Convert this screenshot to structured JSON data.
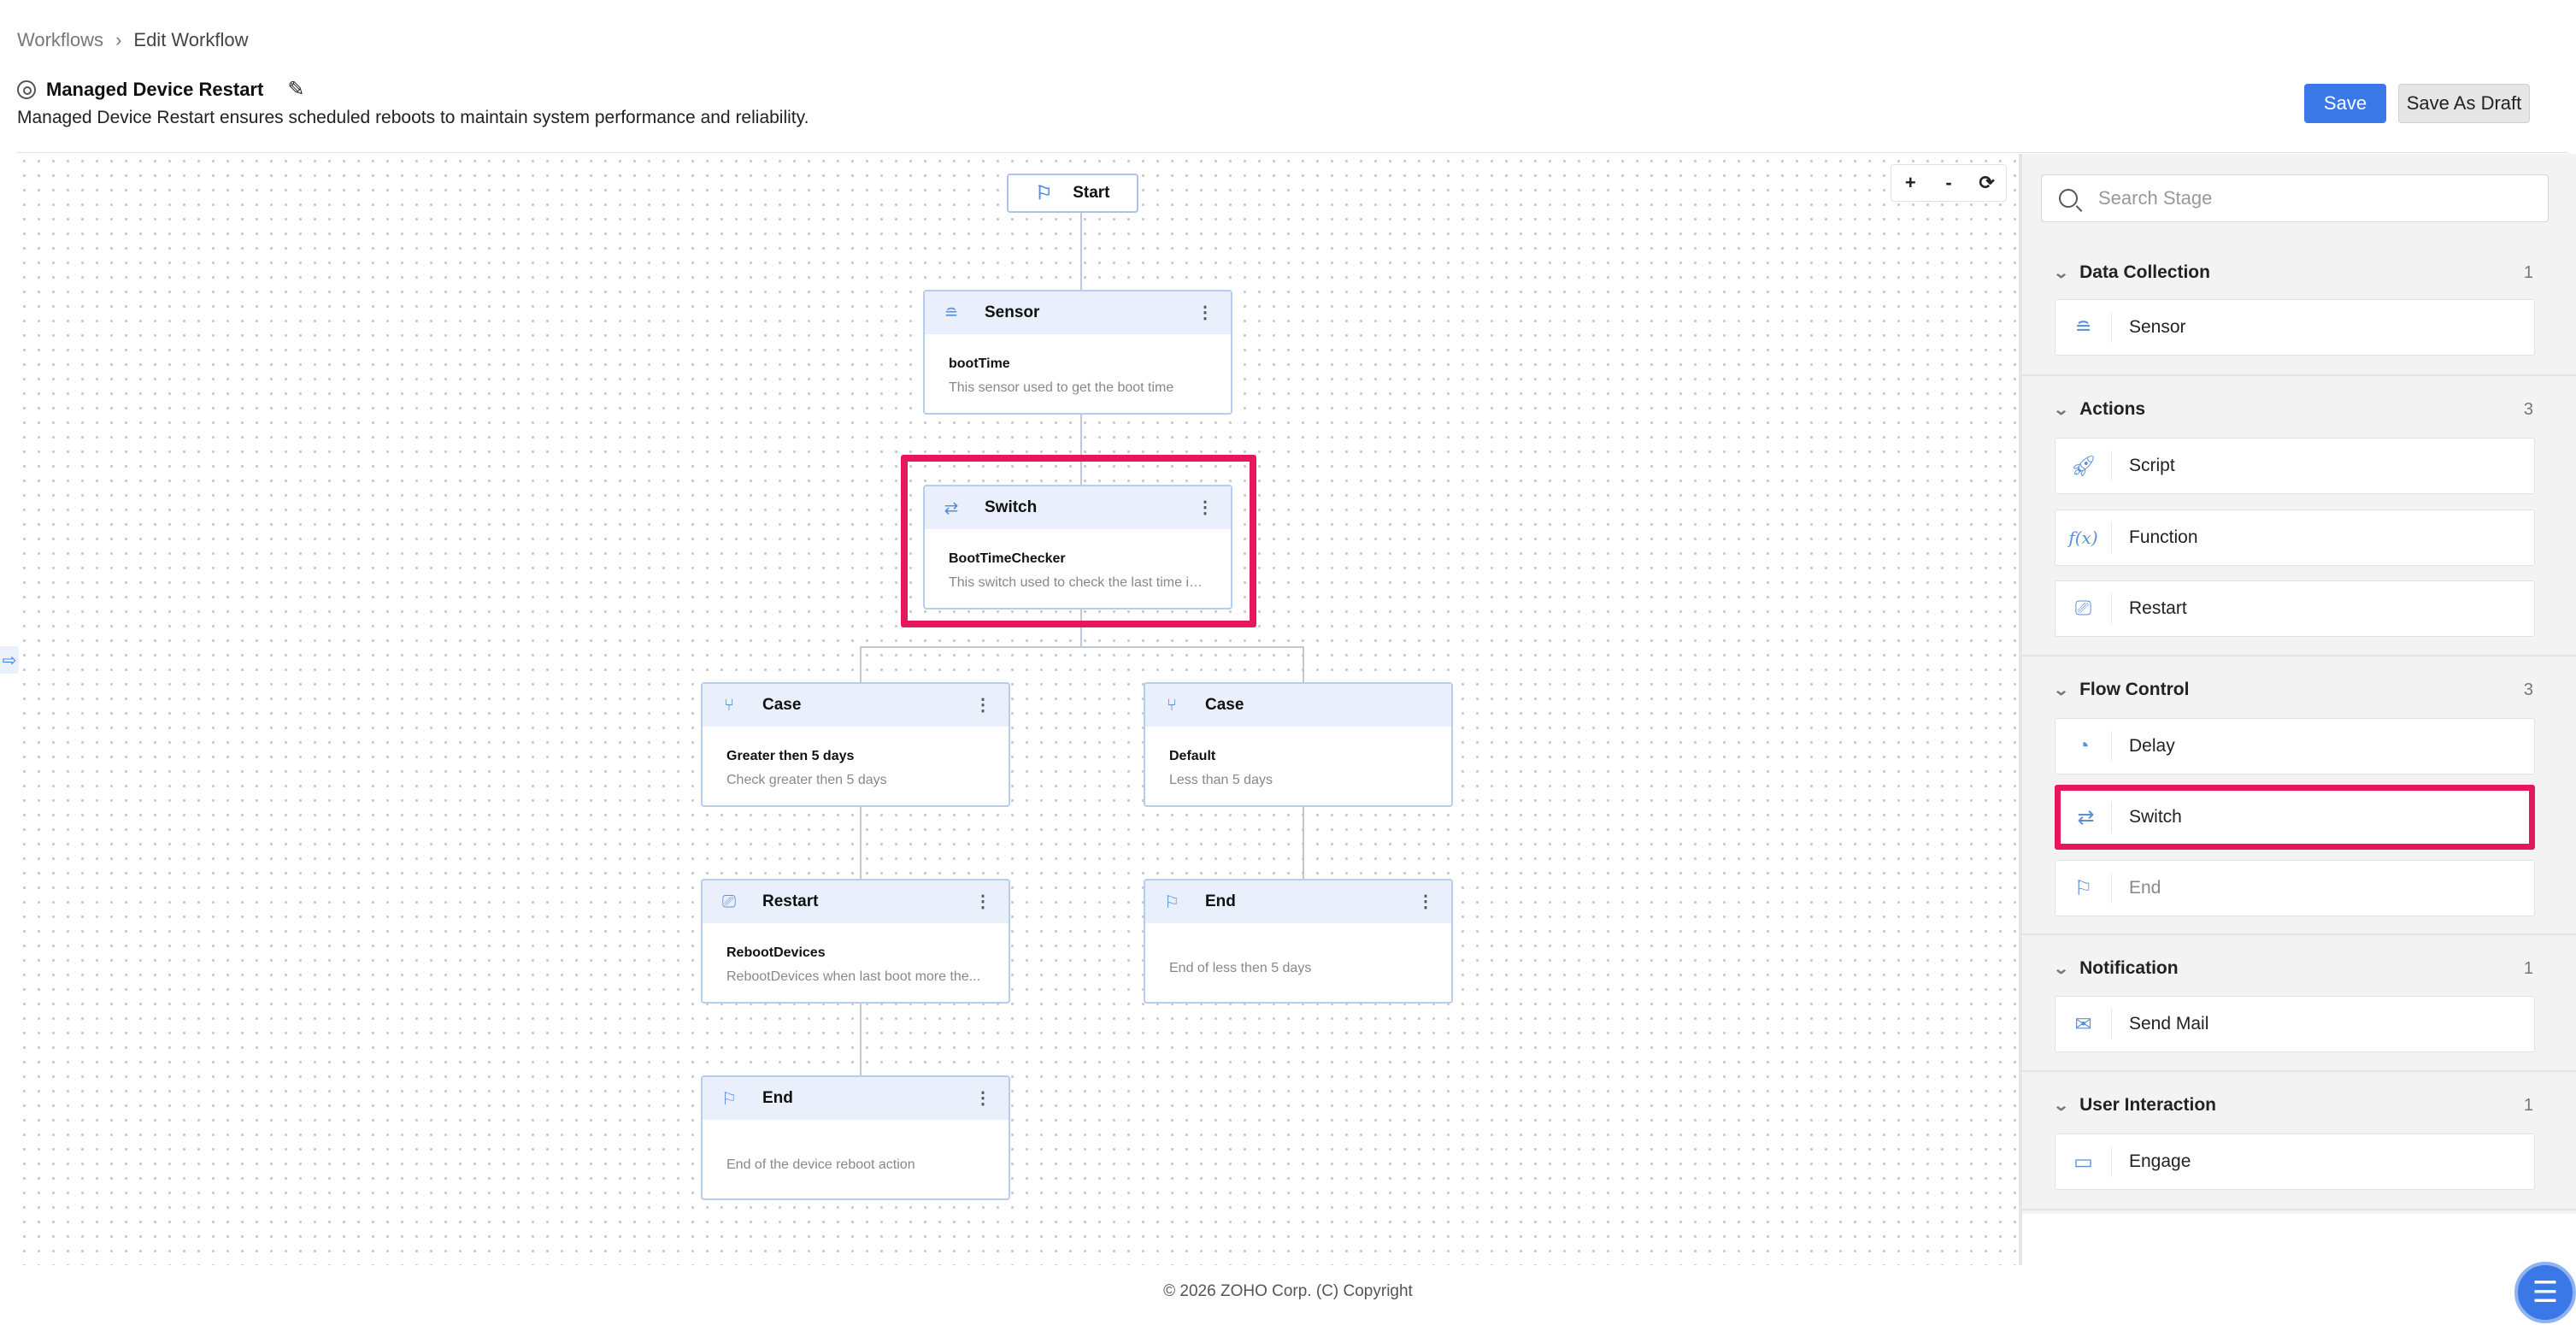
{
  "breadcrumb": {
    "root": "Workflows",
    "separator": "›",
    "current": "Edit Workflow"
  },
  "workflow": {
    "title": "Managed Device Restart",
    "description": "Managed Device Restart ensures scheduled reboots to maintain system performance and reliability."
  },
  "actions": {
    "save": "Save",
    "save_draft": "Save As Draft"
  },
  "zoom": {
    "in": "+",
    "out": "-",
    "reset": "⟳"
  },
  "canvas": {
    "start": {
      "label": "Start",
      "icon": "flag-icon"
    },
    "nodes": {
      "sensor": {
        "type": "Sensor",
        "name": "bootTime",
        "desc": "This sensor used to get the boot time",
        "icon": "sensor-icon"
      },
      "switch": {
        "type": "Switch",
        "name": "BootTimeChecker",
        "desc": "This switch used to check the last time is...",
        "icon": "switch-icon"
      },
      "case1": {
        "type": "Case",
        "name": "Greater then 5 days",
        "desc": "Check greater then 5 days",
        "icon": "case-icon"
      },
      "case2": {
        "type": "Case",
        "name": "Default",
        "desc": "Less than 5 days",
        "icon": "case-icon"
      },
      "restart": {
        "type": "Restart",
        "name": "RebootDevices",
        "desc": "RebootDevices when last boot more the...",
        "icon": "restart-icon"
      },
      "end1": {
        "type": "End",
        "desc": "End of less then 5 days",
        "icon": "flag-icon"
      },
      "end2": {
        "type": "End",
        "desc": "End of the device reboot action",
        "icon": "flag-icon"
      }
    }
  },
  "panel": {
    "search_placeholder": "Search Stage",
    "sections": {
      "data_collection": {
        "title": "Data Collection",
        "count": "1",
        "items": [
          "Sensor"
        ]
      },
      "actions": {
        "title": "Actions",
        "count": "3",
        "items": [
          "Script",
          "Function",
          "Restart"
        ]
      },
      "flow_control": {
        "title": "Flow Control",
        "count": "3",
        "items": [
          "Delay",
          "Switch",
          "End"
        ]
      },
      "notification": {
        "title": "Notification",
        "count": "1",
        "items": [
          "Send Mail"
        ]
      },
      "user_interaction": {
        "title": "User Interaction",
        "count": "1",
        "items": [
          "Engage"
        ]
      }
    }
  },
  "footer": "© 2026 ZOHO Corp. (C) Copyright",
  "colors": {
    "accent": "#3b78e7",
    "highlight": "#e8175d",
    "node_border": "#b6cdee",
    "node_header": "#e9f0fb"
  }
}
